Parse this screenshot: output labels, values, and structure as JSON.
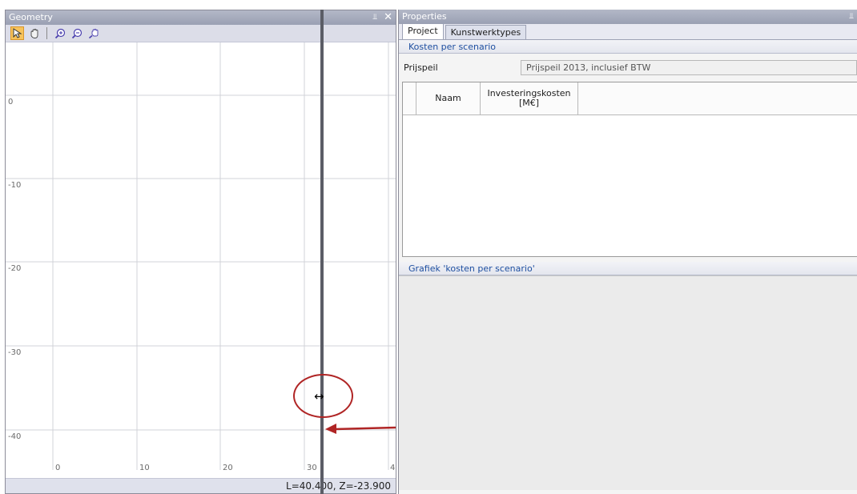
{
  "geometry_panel": {
    "title": "Geometry",
    "pin_glyph": "⫫",
    "close_glyph": "✕",
    "toolbar": {
      "tools": [
        {
          "name": "select-icon",
          "active": true
        },
        {
          "name": "pan-icon",
          "active": false
        },
        {
          "name": "zoom-in-icon",
          "active": false
        },
        {
          "name": "zoom-out-icon",
          "active": false
        },
        {
          "name": "zoom-extents-icon",
          "active": false
        }
      ]
    },
    "plot": {
      "y_ticks": [
        "0",
        "-10",
        "-20",
        "-30",
        "-40"
      ],
      "x_ticks": [
        "0",
        "10",
        "20",
        "30",
        "4"
      ]
    },
    "status": "L=40.400, Z=-23.900"
  },
  "splitter": {
    "cursor_glyph": "↔",
    "highlight_color": "#b02525"
  },
  "properties_panel": {
    "title": "Properties",
    "pin_glyph": "⫫",
    "tabs": [
      {
        "label": "Project",
        "active": true
      },
      {
        "label": "Kunstwerktypes",
        "active": false
      }
    ],
    "sections": {
      "kosten": "Kosten per scenario",
      "grafiek": "Grafiek 'kosten per scenario'"
    },
    "prijspeil": {
      "label": "Prijspeil",
      "value": "Prijspeil 2013, inclusief BTW"
    },
    "grid": {
      "columns": [
        "",
        "Naam",
        "Investeringskosten [M€]",
        ""
      ]
    }
  },
  "colors": {
    "accent_text": "#1e4fa0",
    "annotation_red": "#b02525",
    "titlebar": "#a4a9bb"
  }
}
